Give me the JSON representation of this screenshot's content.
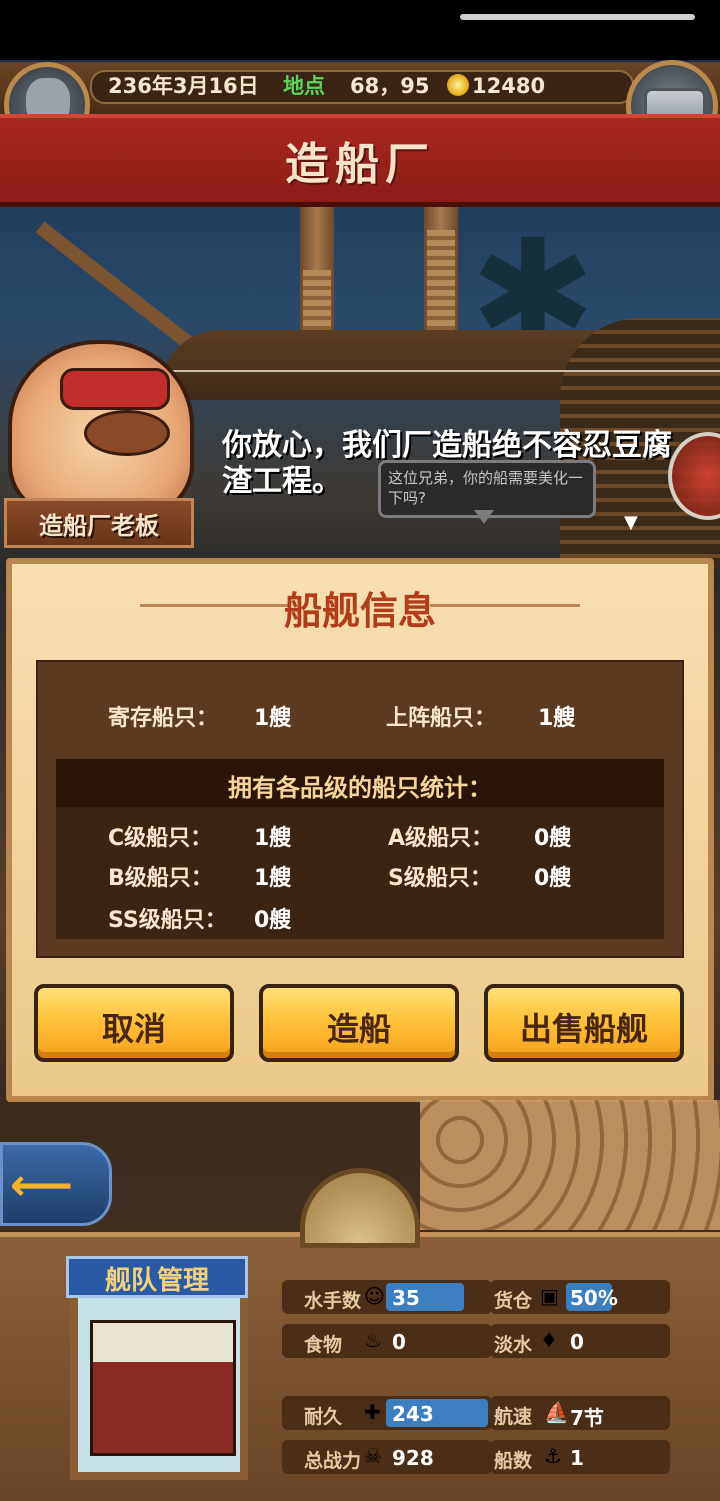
{
  "topbar": {
    "date": "236年3月16日",
    "location_label": "地点",
    "location_value": "68，95",
    "coins": "12480"
  },
  "banner": {
    "title": "造船厂"
  },
  "dialog": {
    "text": "你放心，我们厂造船绝不容忍豆腐渣工程。",
    "bubble": "这位兄弟，你的船需要美化一下吗?",
    "speaker": "造船厂老板"
  },
  "panel": {
    "title": "船舰信息",
    "stored_label": "寄存船只：",
    "stored_value": "1艘",
    "deployed_label": "上阵船只：",
    "deployed_value": "1艘",
    "grade_header": "拥有各品级的船只统计：",
    "grades": [
      {
        "label": "C级船只：",
        "value": "1艘"
      },
      {
        "label": "A级船只：",
        "value": "0艘"
      },
      {
        "label": "B级船只：",
        "value": "1艘"
      },
      {
        "label": "S级船只：",
        "value": "0艘"
      },
      {
        "label": "SS级船只：",
        "value": "0艘"
      }
    ]
  },
  "buttons": {
    "cancel": "取消",
    "build": "造船",
    "sell": "出售船舰"
  },
  "fleet": {
    "label": "舰队管理",
    "stats": [
      {
        "label": "水手数",
        "value": "35",
        "icon": "sailor-icon"
      },
      {
        "label": "货仓",
        "value": "50%",
        "icon": "cargo-icon"
      },
      {
        "label": "食物",
        "value": "0",
        "icon": "meat-icon"
      },
      {
        "label": "淡水",
        "value": "0",
        "icon": "water-icon"
      },
      {
        "label": "耐久",
        "value": "243",
        "icon": "durability-icon"
      },
      {
        "label": "航速",
        "value": "7节",
        "icon": "ship-speed-icon"
      },
      {
        "label": "总战力",
        "value": "928",
        "icon": "combat-icon"
      },
      {
        "label": "船数",
        "value": "1",
        "icon": "ship-count-icon"
      }
    ]
  }
}
